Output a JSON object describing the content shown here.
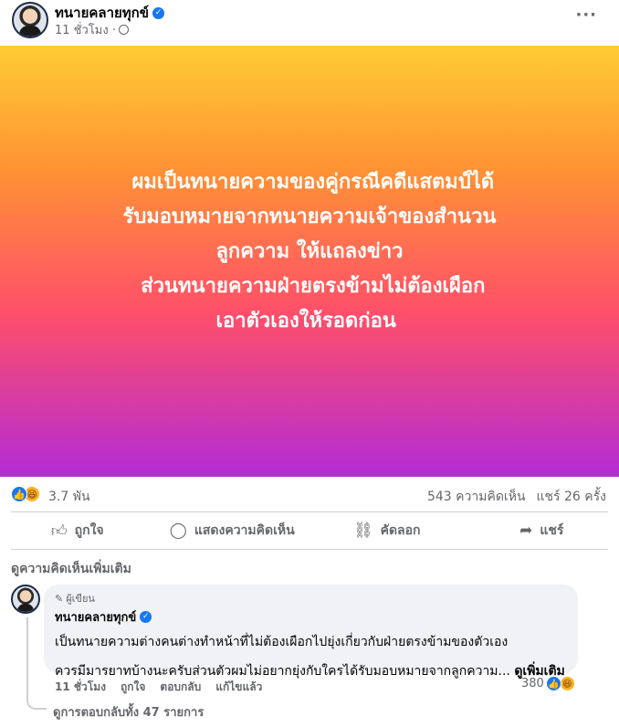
{
  "post": {
    "page_name": "ทนายคลายทุกข์",
    "time": "11 ชั่วโมง ·",
    "more_label": "···",
    "text": "￼ ผมเป็นทนายความของคู่กรณีคดีแสตมป์ได้\nรับมอบหมายจากทนายความเจ้าของสำนวน￼\nลูกความ ให้แถลงข่าว\n￼ ส่วนทนายความฝ่ายตรงข้ามไม่ต้องเผือก\nเอาตัวเองให้รอดก่อน ￼"
  },
  "stats": {
    "reactions": "3.7 พัน",
    "comments": "543 ความคิดเห็น",
    "shares": "แชร์ 26 ครั้ง"
  },
  "actions": {
    "like": "ถูกใจ",
    "comment": "แสดงความคิดเห็น",
    "copy": "คัดลอก",
    "share": "แชร์"
  },
  "comments_section": {
    "view_more": "ดูความคิดเห็นเพิ่มเติม",
    "comment": {
      "badge": "ผู้เขียน",
      "author": "ทนายคลายทุกข์",
      "line1": "เป็นทนายความต่างคนต่างทำหน้าที่ไม่ต้องเผือกไปยุ่งเกี่ยวกับฝ่ายตรงข้ามของตัวเอง",
      "line2": "ควรมีมารยาทบ้างนะครับส่วนตัวผมไม่อยากยุ่งกับใครได้รับมอบหมายจากลูกความ... ",
      "see_more": "ดูเพิ่มเติม",
      "time": "11 ชั่วโมง",
      "like": "ถูกใจ",
      "reply": "ตอบกลับ",
      "edited": "แก้ไขแล้ว",
      "reactions": "380"
    },
    "view_replies": "ดูการตอบกลับทั้ง 47 รายการ"
  },
  "colors": {
    "gradient": [
      "#ffcc33",
      "#ff9433",
      "#ff4f6a",
      "#b32bd6"
    ],
    "accent": "#1877f2",
    "muted": "#65676b"
  },
  "icons": [
    "globe-icon",
    "verified-icon",
    "like-icon",
    "comment-icon",
    "copy-icon",
    "share-icon",
    "haha-icon",
    "pencil-icon"
  ]
}
